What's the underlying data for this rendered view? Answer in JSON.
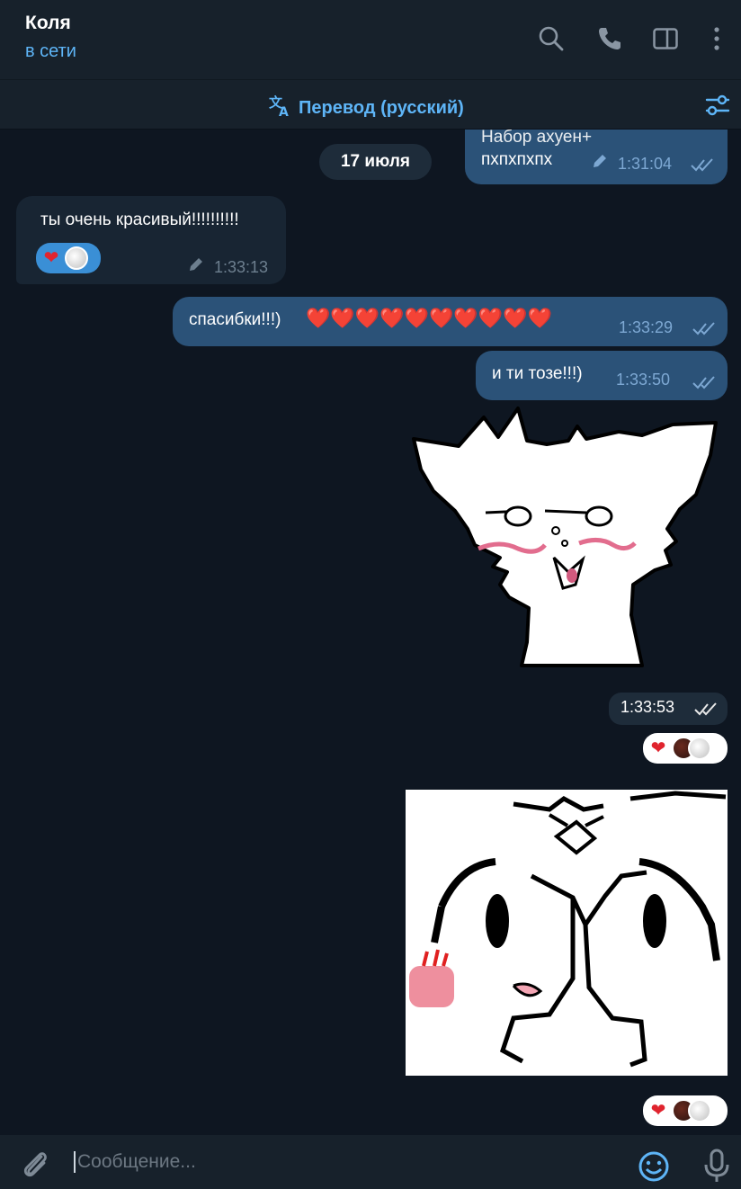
{
  "header": {
    "name": "Коля",
    "status": "в сети",
    "icons": [
      "search-icon",
      "phone-icon",
      "sidebar-icon",
      "more-icon"
    ]
  },
  "translate_bar": {
    "label": "Перевод (русский)",
    "icons": [
      "translate-icon",
      "settings-sliders-icon"
    ]
  },
  "messages": {
    "m0": {
      "text_partial": "Набор  ахуен+",
      "text": "пхпхпхпх",
      "time": "1:31:04",
      "direction": "out",
      "edited": true
    },
    "date": "17 июля",
    "m1": {
      "text": "ты очень красивый!!!!!!!!!!",
      "time": "1:33:13",
      "direction": "in",
      "edited": true,
      "reactions": [
        "❤️",
        "avatar"
      ]
    },
    "m2": {
      "text": "спасибки!!!)",
      "hearts": "❤️❤️❤️❤️❤️❤️❤️❤️❤️❤️",
      "time": "1:33:29",
      "direction": "out"
    },
    "m3": {
      "text": "и ти тозе!!!)",
      "time": "1:33:50",
      "direction": "out"
    },
    "m4": {
      "type": "sticker",
      "time": "1:33:53",
      "reactions": [
        "❤️",
        "avatar",
        "avatar"
      ]
    },
    "m5": {
      "type": "sticker",
      "reactions": [
        "❤️",
        "avatar",
        "avatar"
      ]
    }
  },
  "composer": {
    "placeholder": "Сообщение...",
    "icons": [
      "attach-icon",
      "emoji-icon",
      "microphone-icon"
    ]
  },
  "colors": {
    "background": "#0e1621",
    "header": "#17212b",
    "outgoing": "#2b5278",
    "incoming": "#182533",
    "accent": "#5eb5f7"
  }
}
